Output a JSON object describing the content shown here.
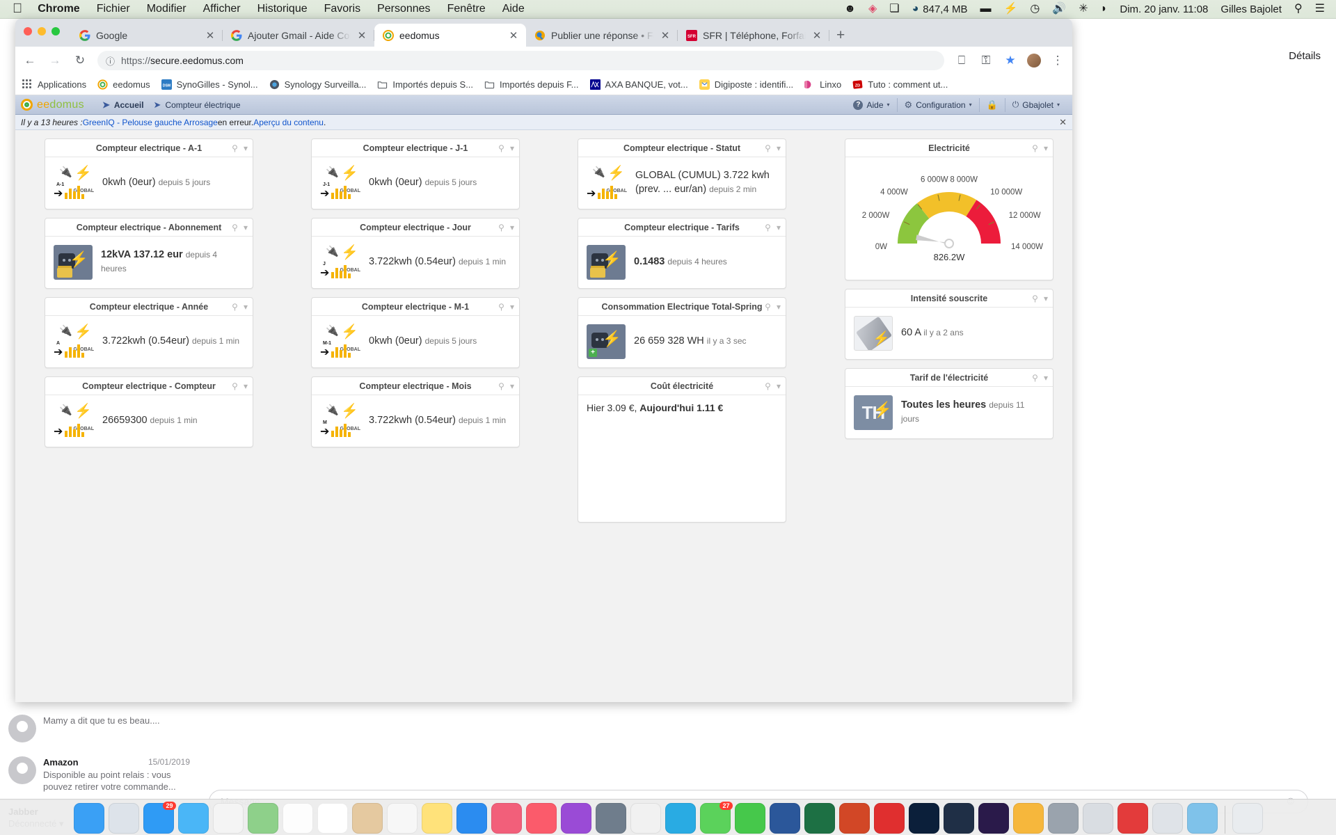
{
  "macos": {
    "apple_icon": "apple-logo",
    "menus": [
      "Chrome",
      "Fichier",
      "Modifier",
      "Afficher",
      "Historique",
      "Favoris",
      "Personnes",
      "Fenêtre",
      "Aide"
    ],
    "status_items": [
      {
        "name": "smiley-icon",
        "glyph": "☻"
      },
      {
        "name": "shield-check-icon",
        "glyph": "◈"
      },
      {
        "name": "window-copy-icon",
        "glyph": "❏"
      },
      {
        "name": "memory-gauge-icon",
        "glyph": "◕"
      }
    ],
    "memory": "847,4 MB",
    "right_icons": [
      {
        "name": "display-icon",
        "glyph": "▬"
      },
      {
        "name": "power-bolt-icon",
        "glyph": "⚡"
      },
      {
        "name": "time-machine-icon",
        "glyph": "◷"
      },
      {
        "name": "volume-icon",
        "glyph": "🔊"
      },
      {
        "name": "bluetooth-icon",
        "glyph": "✳"
      },
      {
        "name": "wifi-icon",
        "glyph": "◗"
      }
    ],
    "datetime": "Dim. 20 janv. 11:08",
    "user": "Gilles Bajolet",
    "search_icon": "search-icon",
    "controlcenter_icon": "list-icon"
  },
  "chrome": {
    "tabs": [
      {
        "title": "Google",
        "favicon": "google-icon",
        "active": false
      },
      {
        "title": "Ajouter Gmail - Aide Compte G",
        "favicon": "google-icon",
        "active": false
      },
      {
        "title": "eedomus",
        "favicon": "eedomus-icon",
        "active": true
      },
      {
        "title": "Publier une réponse • Forum ee",
        "favicon": "forum-icon",
        "active": false
      },
      {
        "title": "SFR | Téléphone, Forfait Mobile",
        "favicon": "sfr-icon",
        "active": false
      }
    ],
    "new_tab_label": "+",
    "close_glyph": "✕",
    "nav": {
      "back": "◀",
      "forward": "▶",
      "reload": "⟳",
      "url_prefix": "https://",
      "url_main": "secure.eedomus.com",
      "info_icon": "info-circle-icon"
    },
    "toolbar_right": [
      {
        "name": "cast-icon",
        "glyph": "▭"
      },
      {
        "name": "key-icon",
        "glyph": "⚷"
      },
      {
        "name": "bookmark-star-icon",
        "glyph": "★"
      },
      {
        "name": "profile-avatar",
        "glyph": ""
      },
      {
        "name": "chrome-menu-icon",
        "glyph": "⋮"
      }
    ],
    "bookmarks": [
      {
        "label": "Applications",
        "icon": "apps-grid-icon"
      },
      {
        "label": "eedomus",
        "icon": "eedomus-icon"
      },
      {
        "label": "SynoGilles - Synol...",
        "icon": "dsm-icon"
      },
      {
        "label": "Synology Surveilla...",
        "icon": "surveillance-icon"
      },
      {
        "label": "Importés depuis S...",
        "icon": "folder-icon"
      },
      {
        "label": "Importés depuis F...",
        "icon": "folder-icon"
      },
      {
        "label": "AXA BANQUE, vot...",
        "icon": "axa-icon"
      },
      {
        "label": "Digiposte : identifi...",
        "icon": "digiposte-icon"
      },
      {
        "label": "Linxo",
        "icon": "linxo-icon"
      },
      {
        "label": "Tuto : comment ut...",
        "icon": "zd-icon"
      }
    ]
  },
  "eedomus": {
    "brand": "eedomus",
    "brand_prefix": "ee",
    "brand_suffix": "domus",
    "breadcrumb": [
      {
        "label": "Accueil",
        "current": true
      },
      {
        "label": "Compteur électrique",
        "current": false
      }
    ],
    "menu": [
      {
        "label": "Aide",
        "icon": "help-icon",
        "caret": "▾"
      },
      {
        "label": "Configuration",
        "icon": "gear-icon",
        "caret": "▾"
      },
      {
        "label": "",
        "icon": "lock-icon",
        "caret": ""
      },
      {
        "label": "Gbajolet",
        "icon": "power-icon",
        "caret": "▾"
      }
    ],
    "notification": {
      "prefix": "Il y a 13 heures : ",
      "link": "GreenIQ - Pelouse gauche Arrosage",
      "middle": " en erreur. ",
      "link2": "Aperçu du contenu",
      "suffix": ".",
      "close": "✕"
    }
  },
  "dashboard": {
    "tools": {
      "search": "search-icon",
      "caret": "chevron-down-icon"
    },
    "columns": [
      {
        "cards": [
          {
            "title": "Compteur electrique - A-1",
            "icon": "meter-icon",
            "tag": "A-1",
            "value": "0kwh (0eur)",
            "age": "depuis 5 jours",
            "kind": "meter"
          },
          {
            "title": "Compteur electrique - Abonnement",
            "icon": "socket-photo-icon",
            "value": "12kVA 137.12 eur",
            "age": "depuis 4 heures",
            "kind": "photo",
            "bold": true
          },
          {
            "title": "Compteur electrique - Année",
            "icon": "meter-icon",
            "tag": "A",
            "value": "3.722kwh (0.54eur)",
            "age": "depuis 1 min",
            "kind": "meter"
          },
          {
            "title": "Compteur electrique - Compteur",
            "icon": "meter-icon",
            "tag": "",
            "value": "26659300",
            "age": "depuis 1 min",
            "kind": "meter"
          }
        ]
      },
      {
        "cards": [
          {
            "title": "Compteur electrique - J-1",
            "icon": "meter-icon",
            "tag": "J-1",
            "value": "0kwh (0eur)",
            "age": "depuis 5 jours",
            "kind": "meter"
          },
          {
            "title": "Compteur electrique - Jour",
            "icon": "meter-icon",
            "tag": "J",
            "value": "3.722kwh (0.54eur)",
            "age": "depuis 1 min",
            "kind": "meter"
          },
          {
            "title": "Compteur electrique - M-1",
            "icon": "meter-icon",
            "tag": "M-1",
            "value": "0kwh (0eur)",
            "age": "depuis 5 jours",
            "kind": "meter"
          },
          {
            "title": "Compteur electrique - Mois",
            "icon": "meter-icon",
            "tag": "M",
            "value": "3.722kwh (0.54eur)",
            "age": "depuis 1 min",
            "kind": "meter"
          }
        ]
      },
      {
        "cards": [
          {
            "title": "Compteur electrique - Statut",
            "icon": "meter-icon",
            "tag": "",
            "value": "GLOBAL (CUMUL) 3.722 kwh (prev. ... eur/an)",
            "age": "depuis 2 min",
            "kind": "meter"
          },
          {
            "title": "Compteur electrique - Tarifs",
            "icon": "socket-photo-icon",
            "value": "0.1483",
            "age": "depuis 4 heures",
            "kind": "photo",
            "bold": true
          },
          {
            "title": "Consommation Electrique Total-Spring",
            "icon": "socket-photo-plus-icon",
            "value": "26 659 328 WH",
            "age": "il y a 3 sec",
            "kind": "photo"
          },
          {
            "title": "Coût électricité",
            "kind": "cost",
            "cost_prev_label": "Hier 3.09 €,",
            "cost_today_label": "Aujourd'hui 1.11 €"
          }
        ]
      },
      {
        "cards": [
          {
            "title": "Electricité",
            "kind": "gauge"
          },
          {
            "title": "Intensité souscrite",
            "icon": "torch-icon",
            "value": "60 A",
            "age": "il y a 2 ans",
            "kind": "torch"
          },
          {
            "title": "Tarif de l'électricité",
            "icon": "th-icon",
            "value": "Toutes les heures",
            "age": "depuis 11 jours",
            "kind": "th",
            "bold": true
          }
        ]
      }
    ]
  },
  "chart_data": {
    "type": "gauge",
    "title": "Electricité",
    "unit": "W",
    "min": 0,
    "max": 14000,
    "value": 826.2,
    "value_label": "826.2W",
    "tick_labels": [
      "0W",
      "2 000W",
      "4 000W",
      "6 000W",
      "8 000W",
      "10 000W",
      "12 000W",
      "14 000W"
    ],
    "tick_values": [
      0,
      2000,
      4000,
      6000,
      8000,
      10000,
      12000,
      14000
    ],
    "bands": [
      {
        "from": 0,
        "to": 4000,
        "color": "#8cc63e",
        "name": "green"
      },
      {
        "from": 4000,
        "to": 9500,
        "color": "#f2c029",
        "name": "yellow"
      },
      {
        "from": 9500,
        "to": 14000,
        "color": "#ec1c3b",
        "name": "red"
      }
    ],
    "needle_color": "#cccccc",
    "legend": "none",
    "grid": false
  },
  "messages_panel": {
    "details_link": "Détails",
    "items": [
      {
        "name": "",
        "date": "",
        "preview": "Mamy a dit que tu es beau...."
      },
      {
        "name": "Amazon",
        "date": "15/01/2019",
        "preview": "Disponible au point relais : vous pouvez retirer votre commande..."
      }
    ],
    "account": {
      "name": "Jabber",
      "status": "Déconnecté",
      "caret": "▾"
    },
    "compose_placeholder": "Message",
    "emoji_icon": "smiley-icon"
  },
  "dock": {
    "items": [
      {
        "name": "finder",
        "color": "#3aa0f5",
        "badge": ""
      },
      {
        "name": "launchpad",
        "color": "#dde3ea",
        "badge": ""
      },
      {
        "name": "mail",
        "color": "#2f9bf5",
        "badge": "29"
      },
      {
        "name": "safari",
        "color": "#4ab6f7",
        "badge": ""
      },
      {
        "name": "chrome",
        "color": "#f4f4f4",
        "badge": ""
      },
      {
        "name": "maps",
        "color": "#8ed08a",
        "badge": ""
      },
      {
        "name": "photos",
        "color": "#fdfdfd",
        "badge": ""
      },
      {
        "name": "calendar",
        "color": "#ffffff",
        "badge": ""
      },
      {
        "name": "contacts",
        "color": "#e5c9a0",
        "badge": ""
      },
      {
        "name": "reminders",
        "color": "#f7f7f7",
        "badge": ""
      },
      {
        "name": "notes",
        "color": "#ffe27a",
        "badge": ""
      },
      {
        "name": "app-store",
        "color": "#2b8cf0",
        "badge": ""
      },
      {
        "name": "itunes",
        "color": "#f25f7a",
        "badge": ""
      },
      {
        "name": "music",
        "color": "#fb5b6b",
        "badge": ""
      },
      {
        "name": "podcasts",
        "color": "#9a4bd6",
        "badge": ""
      },
      {
        "name": "time-machine",
        "color": "#6f7d8c",
        "badge": ""
      },
      {
        "name": "app-cleaner",
        "color": "#f1f1f1",
        "badge": ""
      },
      {
        "name": "skype",
        "color": "#29abe3",
        "badge": ""
      },
      {
        "name": "messages",
        "color": "#5bd25b",
        "badge": "27"
      },
      {
        "name": "facetime",
        "color": "#46c84b",
        "badge": ""
      },
      {
        "name": "word",
        "color": "#2b579a",
        "badge": ""
      },
      {
        "name": "excel",
        "color": "#1d7044",
        "badge": ""
      },
      {
        "name": "powerpoint",
        "color": "#d24726",
        "badge": ""
      },
      {
        "name": "acrobat",
        "color": "#e02f2f",
        "badge": ""
      },
      {
        "name": "photoshop",
        "color": "#0b1f3a",
        "badge": ""
      },
      {
        "name": "lightroom",
        "color": "#1f2f46",
        "badge": ""
      },
      {
        "name": "premiere",
        "color": "#2a1a4a",
        "badge": ""
      },
      {
        "name": "sketch",
        "color": "#f6b73c",
        "badge": ""
      },
      {
        "name": "preferences",
        "color": "#9aa3ad",
        "badge": ""
      },
      {
        "name": "utilities",
        "color": "#d9dde2",
        "badge": ""
      },
      {
        "name": "parallels",
        "color": "#e33b3b",
        "badge": ""
      },
      {
        "name": "downloads",
        "color": "#dfe3e8",
        "badge": ""
      },
      {
        "name": "folder",
        "color": "#7fc2ea",
        "badge": ""
      },
      {
        "name": "trash",
        "color": "#e9ecef",
        "badge": ""
      }
    ]
  }
}
